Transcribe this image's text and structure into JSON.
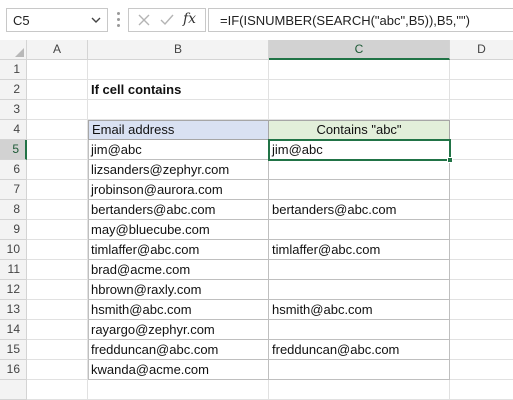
{
  "name_box": {
    "value": "C5"
  },
  "formula_bar": {
    "fx_label": "fx",
    "formula": "=IF(ISNUMBER(SEARCH(\"abc\",B5)),B5,\"\")"
  },
  "columns": [
    "A",
    "B",
    "C",
    "D"
  ],
  "rows": [
    "1",
    "2",
    "3",
    "4",
    "5",
    "6",
    "7",
    "8",
    "9",
    "10",
    "11",
    "12",
    "13",
    "14",
    "15",
    "16"
  ],
  "selected": {
    "column": "C",
    "row": "5"
  },
  "sheet": {
    "title": "If cell contains",
    "table": {
      "headers": [
        "Email address",
        "Contains \"abc\""
      ],
      "rows": [
        [
          "jim@abc",
          "jim@abc"
        ],
        [
          "lizsanders@zephyr.com",
          ""
        ],
        [
          "jrobinson@aurora.com",
          ""
        ],
        [
          "bertanders@abc.com",
          "bertanders@abc.com"
        ],
        [
          "may@bluecube.com",
          ""
        ],
        [
          "timlaffer@abc.com",
          "timlaffer@abc.com"
        ],
        [
          "brad@acme.com",
          ""
        ],
        [
          "hbrown@raxly.com",
          ""
        ],
        [
          "hsmith@abc.com",
          "hsmith@abc.com"
        ],
        [
          "rayargo@zephyr.com",
          ""
        ],
        [
          "fredduncan@abc.com",
          "fredduncan@abc.com"
        ],
        [
          "kwanda@acme.com",
          ""
        ]
      ]
    }
  },
  "colors": {
    "accent": "#217346",
    "header_b": "#d9e1f2",
    "header_c": "#e2efda"
  }
}
